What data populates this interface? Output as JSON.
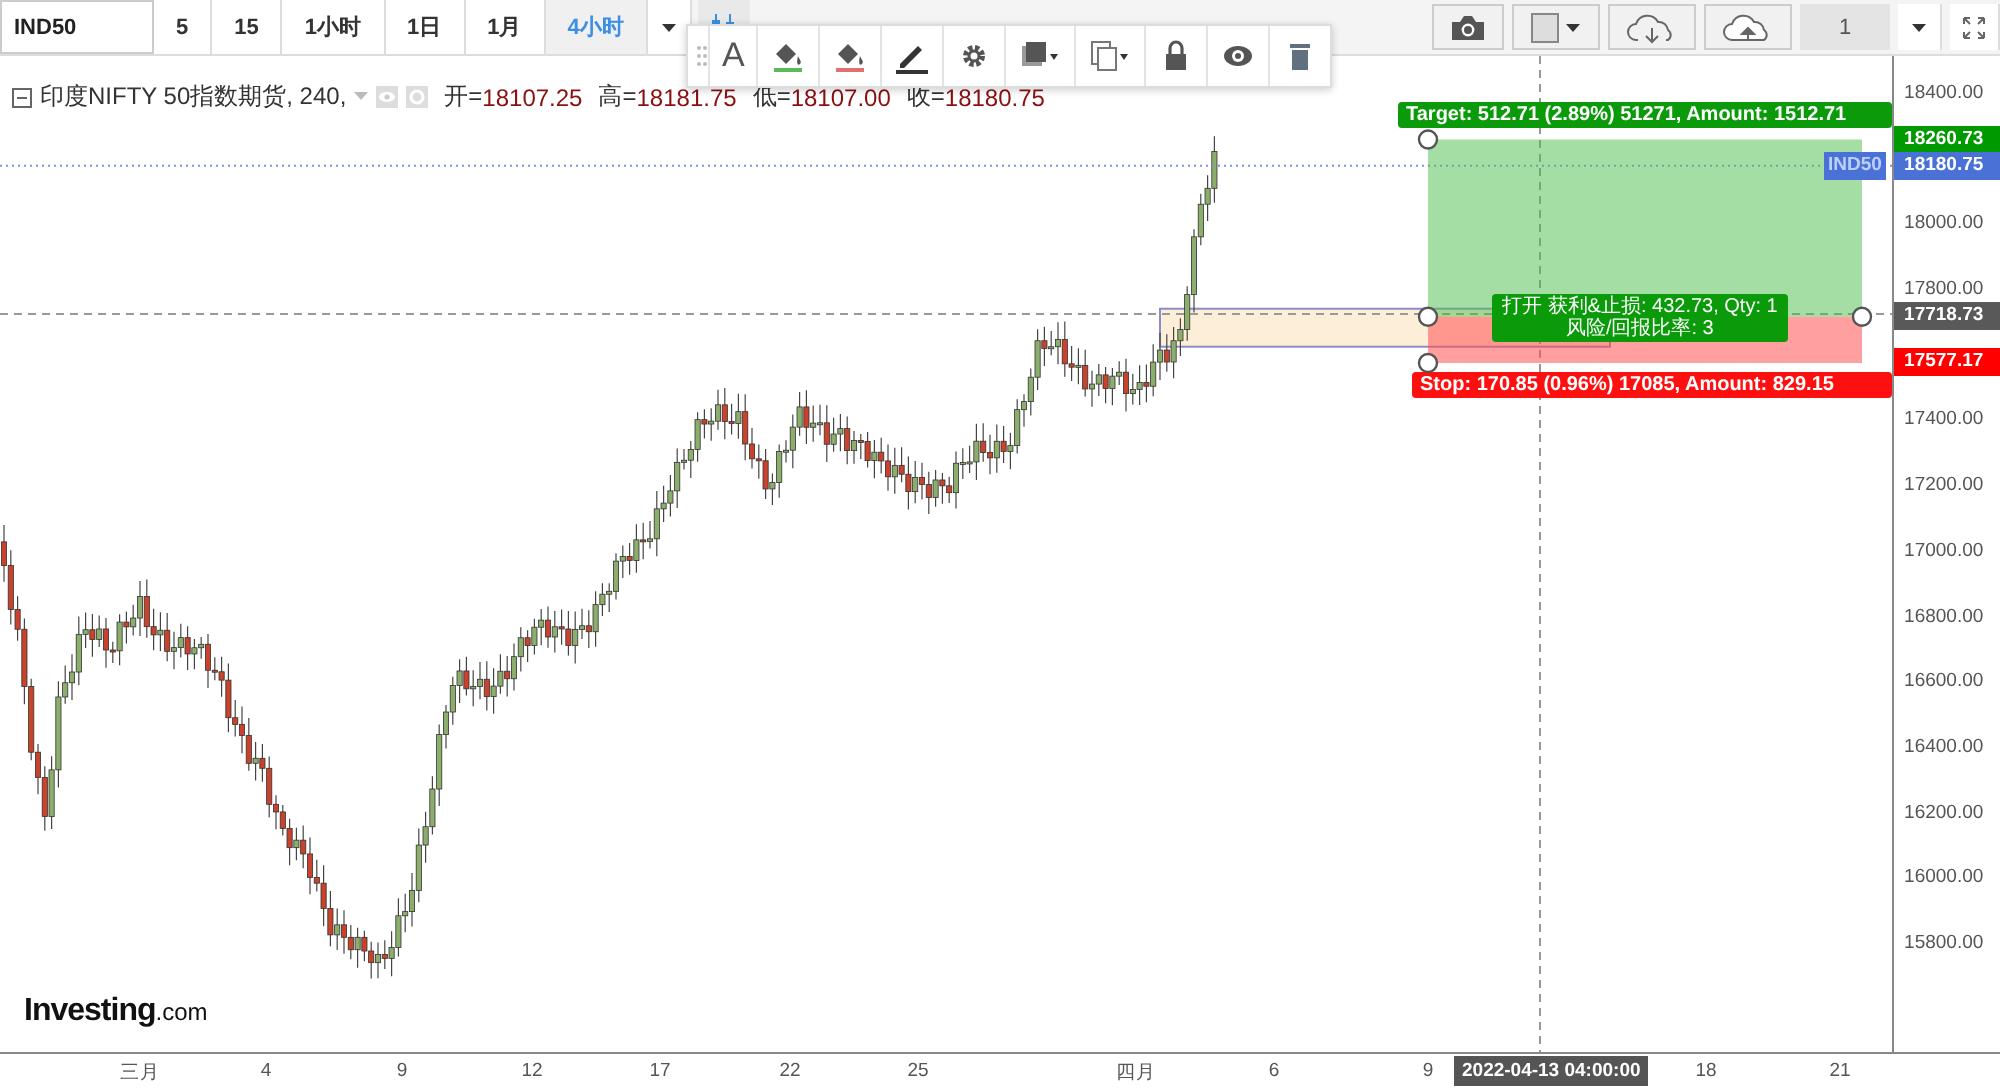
{
  "toolbar": {
    "symbol": "IND50",
    "intervals": [
      {
        "label": "5",
        "selected": false
      },
      {
        "label": "15",
        "selected": false
      },
      {
        "label": "1小时",
        "selected": false
      },
      {
        "label": "1日",
        "selected": false
      },
      {
        "label": "1月",
        "selected": false
      },
      {
        "label": "4小时",
        "selected": true
      }
    ],
    "layout_number": "1"
  },
  "drawing_toolbar": {
    "text_tool": "A"
  },
  "legend": {
    "title": "印度NIFTY 50指数期货, 240,",
    "ohlc": [
      {
        "label": "开=",
        "value": "18107.25"
      },
      {
        "label": "高=",
        "value": "18181.75"
      },
      {
        "label": "低=",
        "value": "18107.00"
      },
      {
        "label": "收=",
        "value": "18180.75"
      }
    ]
  },
  "price_axis": {
    "ticks": [
      "18400.00",
      "18000.00",
      "17800.00",
      "17400.00",
      "17200.00",
      "17000.00",
      "16800.00",
      "16600.00",
      "16400.00",
      "16200.00",
      "16000.00",
      "15800.00"
    ],
    "tags": [
      {
        "kind": "target",
        "value": "18260.73",
        "color": "#009900"
      },
      {
        "kind": "last",
        "value": "18180.75",
        "color": "#4a72d6"
      },
      {
        "kind": "entry",
        "value": "17718.73",
        "color": "#595959"
      },
      {
        "kind": "stop",
        "value": "17577.17",
        "color": "#ff0000"
      }
    ],
    "symbol_tag": "IND50"
  },
  "position": {
    "target_label": "Target: 512.71 (2.89%) 51271, Amount: 1512.71",
    "stop_label": "Stop: 170.85 (0.96%) 17085, Amount: 829.15",
    "summary_lines": [
      "打开 获利&止损: 432.73, Qty: 1",
      "风险/回报比率: 3"
    ]
  },
  "time_axis": {
    "labels": [
      "三月",
      "4",
      "9",
      "12",
      "17",
      "22",
      "25",
      "四月",
      "6",
      "9",
      "18",
      "21"
    ],
    "crosshair_label": "2022-04-13 04:00:00"
  },
  "logo": {
    "brand": "Investing",
    "suffix": ".com"
  }
}
